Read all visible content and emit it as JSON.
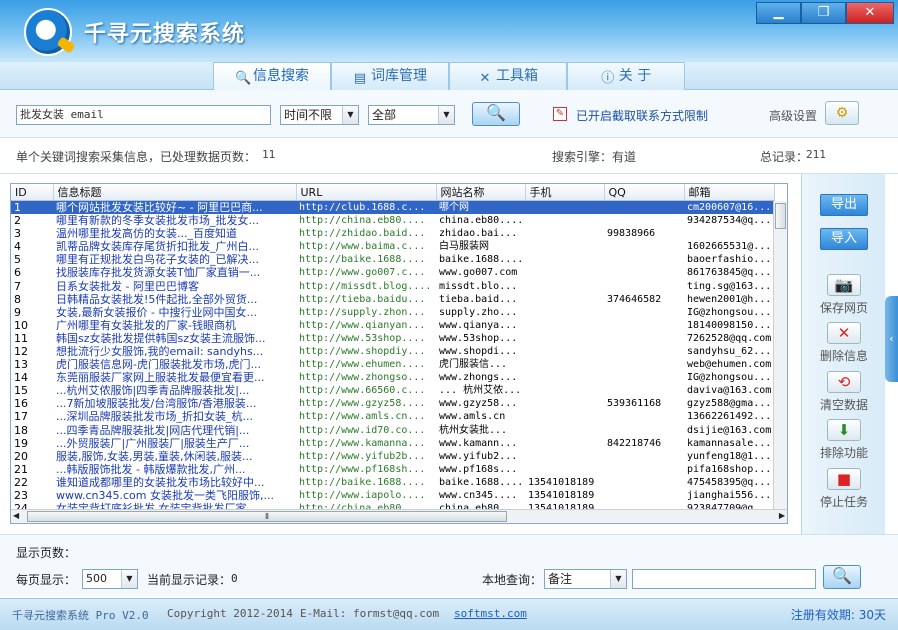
{
  "app": {
    "title": "千寻元搜索系统"
  },
  "window_buttons": [
    "▁",
    "❐",
    "✕"
  ],
  "tabs": [
    {
      "label": "信息搜索",
      "icon": "search-icon"
    },
    {
      "label": "词库管理",
      "icon": "book-icon"
    },
    {
      "label": "工具箱",
      "icon": "tools-icon"
    },
    {
      "label": "关 于",
      "icon": "info-icon"
    }
  ],
  "search": {
    "keyword_value": "批发女装 email",
    "time_value": "时间不限",
    "scope_value": "全部",
    "contact_filter_label": "已开启截取联系方式限制",
    "advanced_label": "高级设置"
  },
  "info": {
    "status": "单个关键词搜索采集信息，已处理数据页数：",
    "pages": "11",
    "engine": "搜索引擎：有道",
    "total_label": "总记录：",
    "total": "211"
  },
  "columns": [
    "ID",
    "信息标题",
    "URL",
    "网站名称",
    "手机",
    "QQ",
    "邮箱"
  ],
  "rows": [
    [
      "1",
      "哪个网站批发女装比较好~ - 阿里巴巴商...",
      "http://club.1688.c...",
      "哪个网",
      "",
      "",
      "cm200607@16..."
    ],
    [
      "2",
      "哪里有新款的冬季女装批发市场_批发女...",
      "http://china.eb80....",
      "china.eb80....",
      "",
      "",
      "934287534@q..."
    ],
    [
      "3",
      "温州哪里批发高仿的女装..._百度知道",
      "http://zhidao.baid...",
      "zhidao.bai...",
      "",
      "99838966",
      ""
    ],
    [
      "4",
      "凯蒂品牌女装库存尾货折扣批发_广州白...",
      "http://www.baima.c...",
      "白马服装网",
      "",
      "",
      "1602665531@..."
    ],
    [
      "5",
      "哪里有正规批发白鸟花子女装的_已解决...",
      "http://baike.1688....",
      "baike.1688....",
      "",
      "",
      "baoerfashio..."
    ],
    [
      "6",
      "找服装库存批发货源女装T恤厂家直销一...",
      "http://www.go007.c...",
      "www.go007.com",
      "",
      "",
      "861763845@q..."
    ],
    [
      "7",
      "日系女装批发 - 阿里巴巴博客",
      "http://missdt.blog....",
      "missdt.blo...",
      "",
      "",
      "ting.sg@163..."
    ],
    [
      "8",
      "日韩精品女装批发!5件起批,全部外贸货...",
      "http://tieba.baidu...",
      "tieba.baid...",
      "",
      "374646582",
      "hewen2001@h..."
    ],
    [
      "9",
      "女装,最新女装报价 - 中搜行业网中国女...",
      "http://supply.zhon...",
      "supply.zho...",
      "",
      "",
      "IG@zhongsou..."
    ],
    [
      "10",
      "广州哪里有女装批发的厂家-钱眼商机",
      "http://www.qianyan...",
      "www.qianya...",
      "",
      "",
      "18140098150..."
    ],
    [
      "11",
      "韩国sz女装批发提供韩国sz女装主流服饰...",
      "http://www.53shop....",
      "www.53shop...",
      "",
      "",
      "7262528@qq.com"
    ],
    [
      "12",
      "想批流行少女服饰,我的email: sandyhs...",
      "http://www.shopdiy...",
      "www.shopdi...",
      "",
      "",
      "sandyhsu_62..."
    ],
    [
      "13",
      "虎门服装信息网-虎门服装批发市场,虎门...",
      "http://www.ehumen....",
      "虎门服装信...",
      "",
      "",
      "web@ehumen.com"
    ],
    [
      "14",
      "东莞丽服装厂家网上服装批发最便宜看更...",
      "http://www.zhongso...",
      "www.zhongs...",
      "",
      "",
      "IG@zhongsou..."
    ],
    [
      "15",
      "...杭州艾侬服饰|四季青品牌服装批发|...",
      "http://www.66560.c...",
      "... 杭州艾侬...",
      "",
      "",
      "daviva@163.com"
    ],
    [
      "16",
      "...7新加坡服装批发/台湾服饰/香港服装...",
      "http://www.gzyz58....",
      "www.gzyz58...",
      "",
      "539361168",
      "gzyz588@gma..."
    ],
    [
      "17",
      "...深圳品牌服装批发市场_折扣女装_杭...",
      "http://www.amls.cn...",
      "www.amls.cn",
      "",
      "",
      "13662261492..."
    ],
    [
      "18",
      "...四季青品牌服装批发|网店代理代销|...",
      "http://www.id70.co...",
      "杭州女装批...",
      "",
      "",
      "dsijie@163.com"
    ],
    [
      "19",
      "...外贸服装厂|广州服装厂|服装生产厂...",
      "http://www.kamanna...",
      "www.kamann...",
      "",
      "842218746",
      "kamannasale..."
    ],
    [
      "20",
      "服装,服饰,女装,男装,童装,休闲装,服装...",
      "http://www.yifub2b...",
      "www.yifub2...",
      "",
      "",
      "yunfeng18@1..."
    ],
    [
      "21",
      "...韩版服饰批发 - 韩版爆款批发,广州...",
      "http://www.pf168sh...",
      "www.pf168s...",
      "",
      "",
      "pifa168shop..."
    ],
    [
      "22",
      "谁知道成都哪里的女装批发市场比较好中...",
      "http://baike.1688....",
      "baike.1688....",
      "13541018189",
      "",
      "475458395@q..."
    ],
    [
      "23",
      "www.cn345.com 女装批发一类飞阳服饰,...",
      "http://www.iapolo....",
      "www.cn345....",
      "13541018189",
      "",
      "jianghai556..."
    ],
    [
      "24",
      "女装宝背打底衫批发,女装宝背批发厂家...",
      "http://china.eb80....",
      "china.eb80....",
      "13541018189",
      "",
      "923847709@q..."
    ]
  ],
  "side": {
    "export_label": "导出",
    "import_label": "导入",
    "save_page_label": "保存网页",
    "delete_label": "删除信息",
    "clear_label": "清空数据",
    "exclude_label": "排除功能",
    "stop_label": "停止任务"
  },
  "bottom": {
    "pages_label": "显示页数：",
    "per_page_label": "每页显示：",
    "per_page_value": "500",
    "current_label": "当前显示记录：",
    "current_value": "0",
    "local_query_label": "本地查询：",
    "query_field_value": "备注",
    "query_input_value": ""
  },
  "footer": {
    "product": "千寻元搜索系统 Pro V2.0",
    "copyright": "Copyright 2012-2014",
    "email": "E-Mail: formst@qq.com",
    "site": "softmst.com",
    "expiry": "注册有效期: 30天"
  }
}
